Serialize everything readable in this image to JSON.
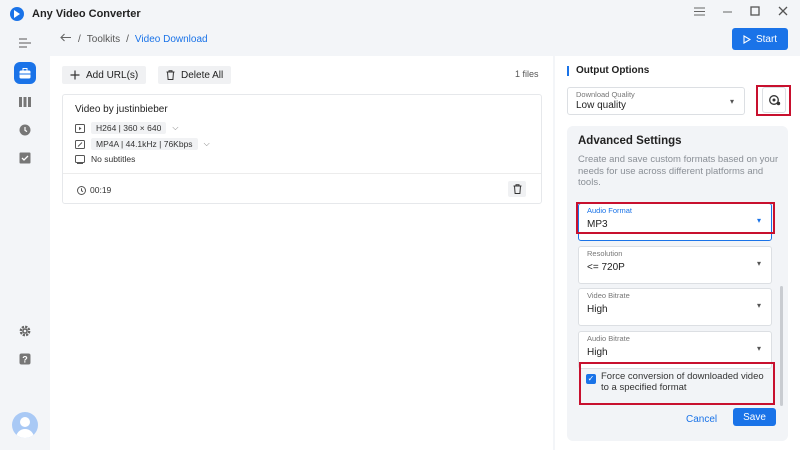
{
  "app": {
    "title": "Any Video Converter"
  },
  "window": {
    "menu_icon": "hamburger-icon",
    "minimize_icon": "minimize-icon",
    "maximize_icon": "maximize-icon",
    "close_icon": "close-icon"
  },
  "breadcrumb": {
    "root": "Toolkits",
    "current": "Video Download"
  },
  "toolbar": {
    "start_label": "Start",
    "add_urls_label": "Add URL(s)",
    "delete_all_label": "Delete All",
    "files_count": "1 files"
  },
  "file": {
    "title": "Video by justinbieber",
    "video_info": "H264 | 360 × 640",
    "audio_info": "MP4A | 44.1kHz | 76Kbps",
    "subtitles": "No subtitles",
    "duration": "00:19"
  },
  "output": {
    "title": "Output Options",
    "quality_label": "Download Quality",
    "quality_value": "Low quality"
  },
  "advanced": {
    "title": "Advanced Settings",
    "description": "Create and save custom formats based on your needs for use across different platforms and tools.",
    "audio_format_label": "Audio Format",
    "audio_format_value": "MP3",
    "resolution_label": "Resolution",
    "resolution_value": "<= 720P",
    "video_bitrate_label": "Video Bitrate",
    "video_bitrate_value": "High",
    "audio_bitrate_label": "Audio Bitrate",
    "audio_bitrate_value": "High",
    "force_conversion_label": "Force conversion of downloaded video to a specified format",
    "force_conversion_checked": true,
    "cancel_label": "Cancel",
    "save_label": "Save"
  },
  "colors": {
    "accent": "#1a73e8",
    "highlight": "#c8102e"
  }
}
